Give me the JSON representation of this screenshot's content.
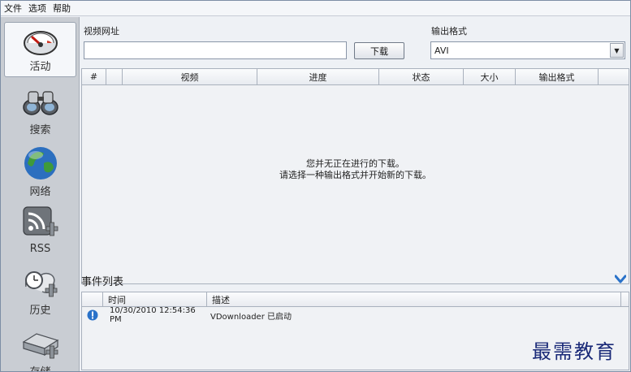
{
  "menu": {
    "items": [
      "文件",
      "选项",
      "帮助"
    ]
  },
  "sidebar": {
    "items": [
      {
        "label": "活动"
      },
      {
        "label": "搜索"
      },
      {
        "label": "网络"
      },
      {
        "label": "RSS"
      },
      {
        "label": "历史"
      },
      {
        "label": "存储"
      }
    ]
  },
  "download": {
    "url_label": "视频网址",
    "url_value": "",
    "button_label": "下载",
    "format_label": "输出格式",
    "format_value": "AVI"
  },
  "table": {
    "columns": [
      "#",
      "",
      "视频",
      "进度",
      "状态",
      "大小",
      "输出格式"
    ],
    "empty_line1": "您并无正在进行的下载。",
    "empty_line2": "请选择一种输出格式并开始新的下载。"
  },
  "events": {
    "title": "事件列表",
    "columns": [
      "",
      "时间",
      "描述"
    ],
    "rows": [
      {
        "time": "10/30/2010 12:54:36 PM",
        "desc": "VDownloader 已启动"
      }
    ]
  },
  "watermark": "最需教育",
  "colors": {
    "accent": "#2a72c9",
    "sidebar_bg": "#c9cdd3"
  }
}
